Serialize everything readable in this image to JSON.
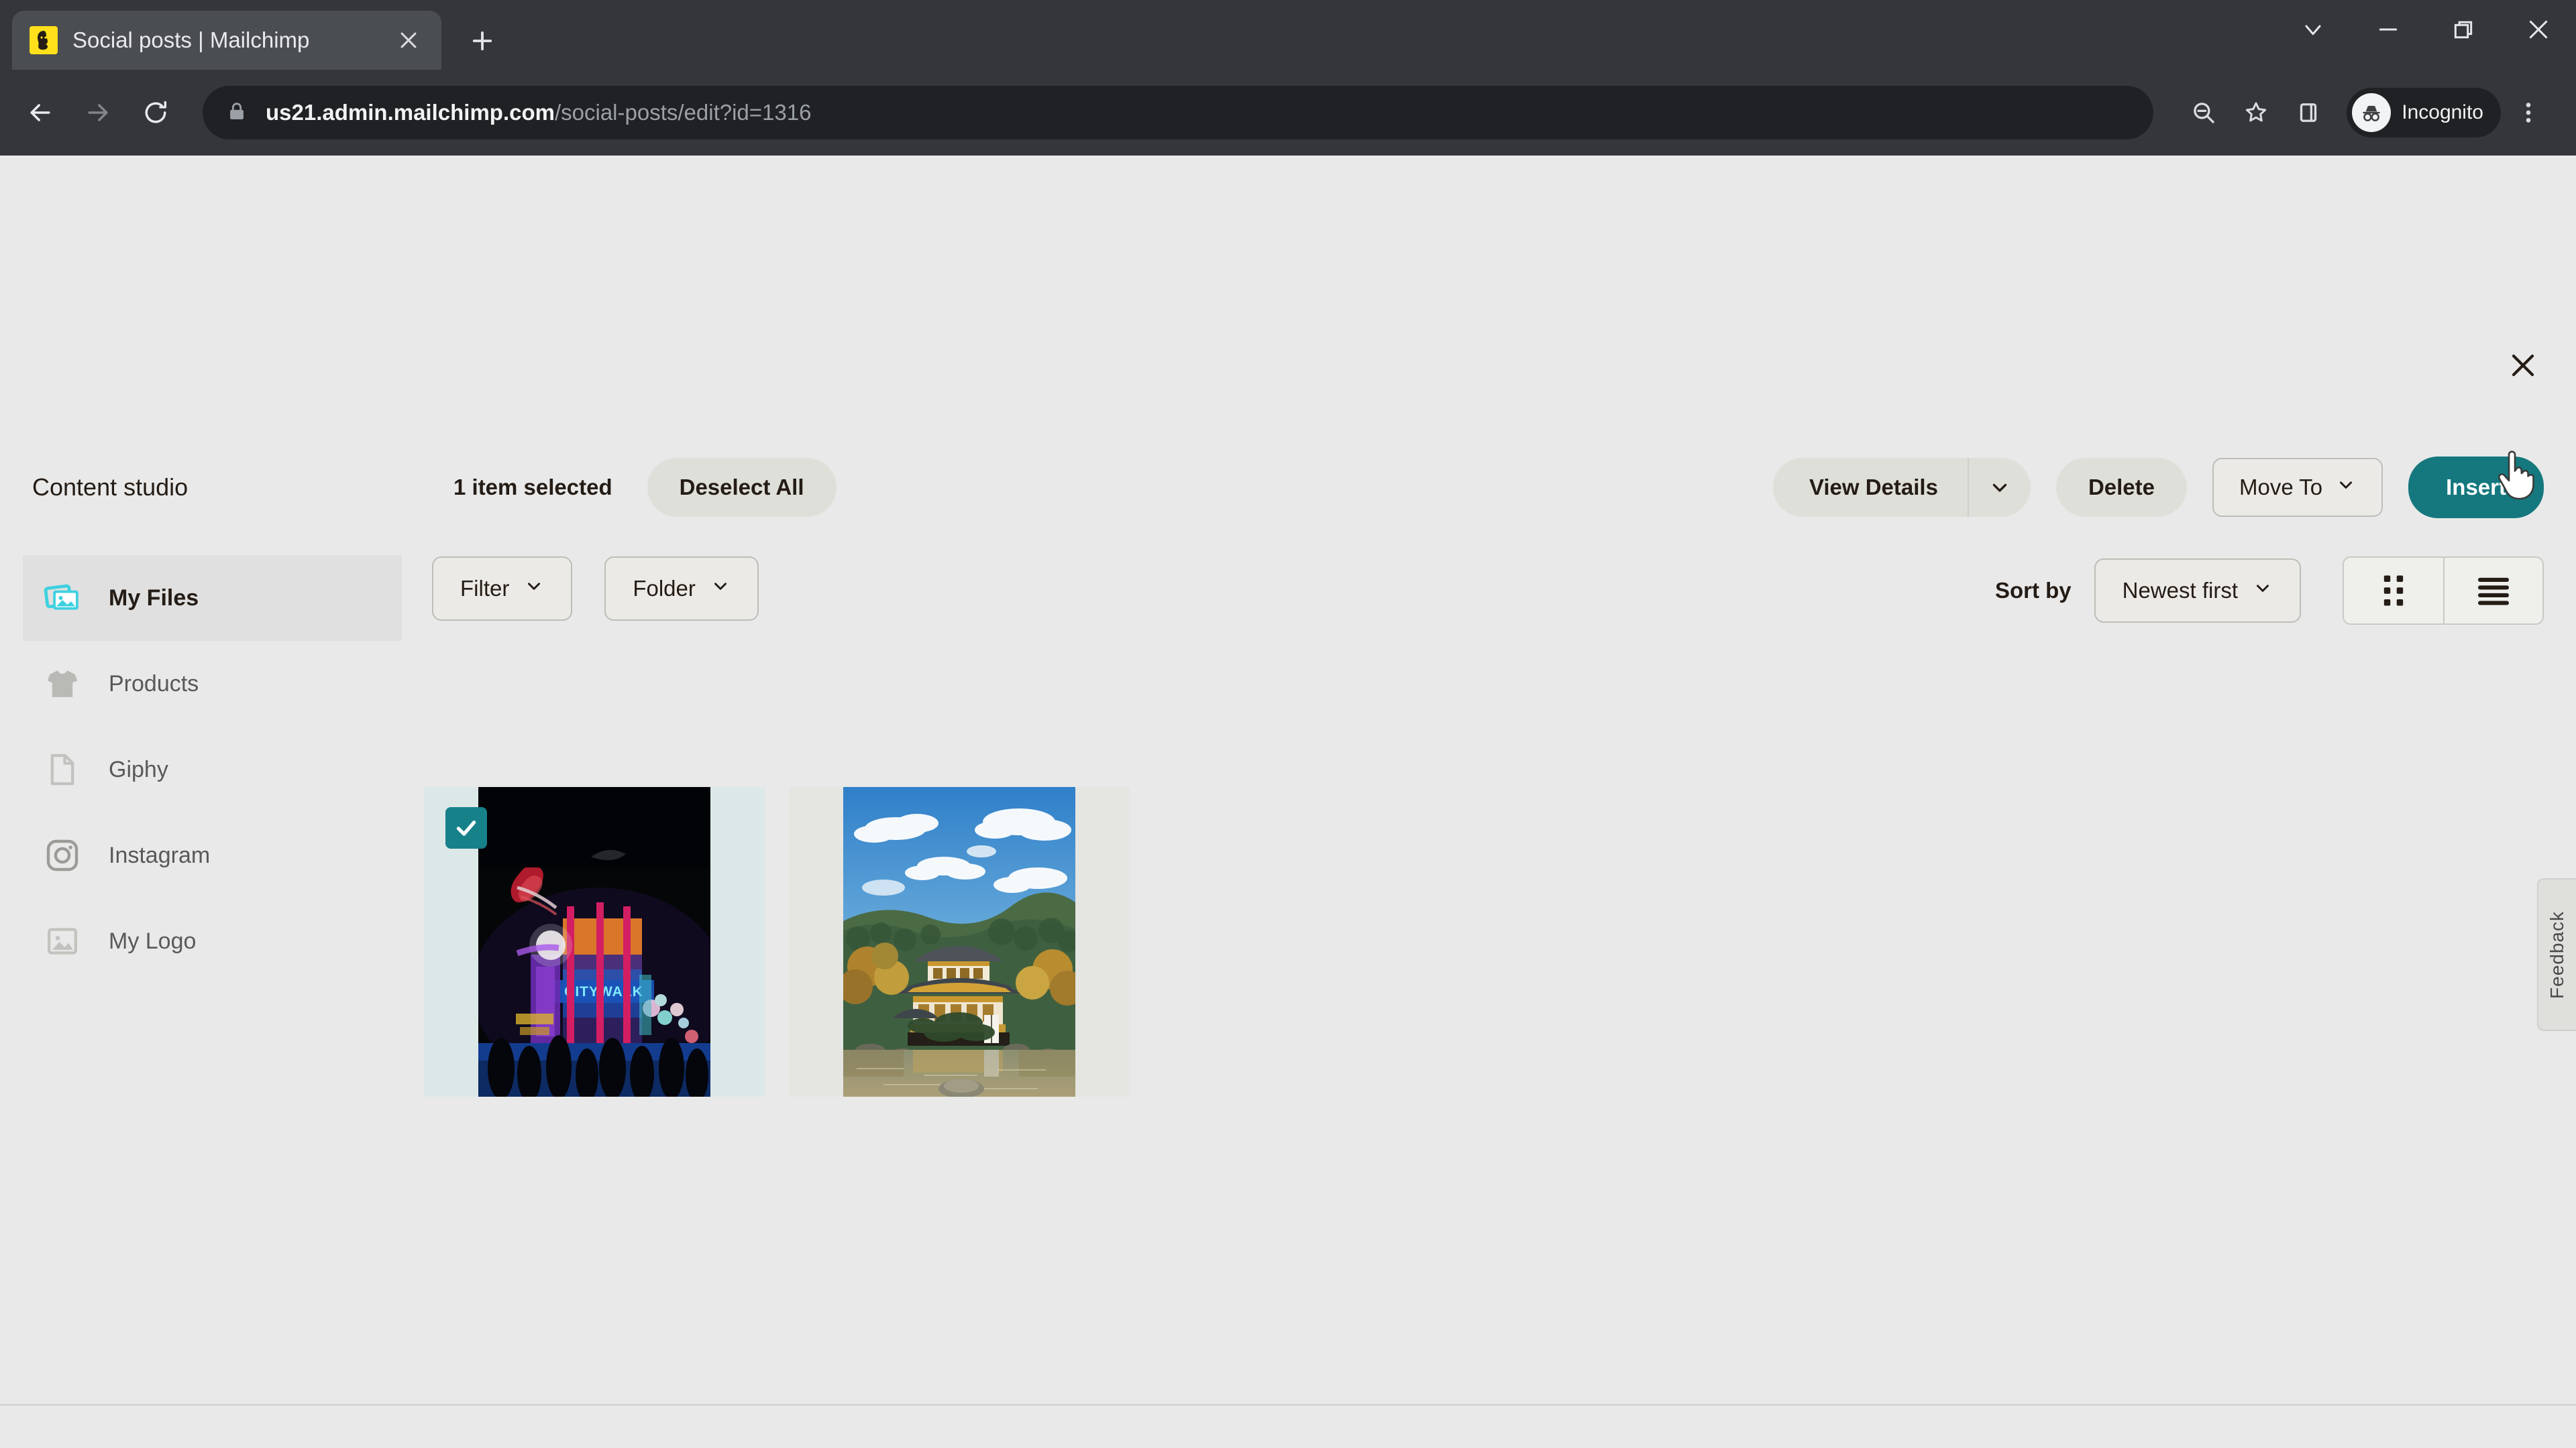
{
  "browser": {
    "tab": {
      "title": "Social posts | Mailchimp",
      "favicon_name": "mailchimp-favicon",
      "close_label": "×"
    },
    "new_tab_label": "+",
    "window_controls": [
      {
        "name": "tab-search-button",
        "glyph": "⌄"
      },
      {
        "name": "minimize-button",
        "glyph": "−"
      },
      {
        "name": "restore-button",
        "glyph": "❐"
      },
      {
        "name": "close-window-button",
        "glyph": "×"
      }
    ],
    "nav": {
      "back_label": "←",
      "forward_label": "→",
      "reload_label": "↻"
    },
    "omnibox": {
      "lock_icon": "lock-icon",
      "url_domain": "us21.admin.mailchimp.com",
      "url_path": "/social-posts/edit?id=1316",
      "full_url": "us21.admin.mailchimp.com/social-posts/edit?id=1316"
    },
    "toolbar_icons": [
      {
        "name": "zoom-out-icon",
        "label": "Zoom"
      },
      {
        "name": "bookmark-star-icon",
        "label": "Bookmark"
      },
      {
        "name": "side-panel-icon",
        "label": "Side panel"
      },
      {
        "name": "menu-kebab-icon",
        "label": "Customize and control"
      }
    ],
    "incognito": {
      "label": "Incognito",
      "icon_name": "incognito-icon"
    }
  },
  "modal": {
    "close_label": "×",
    "title": "Content studio",
    "selection": {
      "count_text": "1 item selected",
      "deselect_label": "Deselect All"
    },
    "actions": {
      "view_details_label": "View Details",
      "view_details_caret": "⌄",
      "delete_label": "Delete",
      "move_to_label": "Move To",
      "move_to_caret": "⌄",
      "insert_label": "Insert"
    }
  },
  "sidebar": {
    "items": [
      {
        "label": "My Files",
        "icon": "photos-stack-icon",
        "active": true
      },
      {
        "label": "Products",
        "icon": "tshirt-icon",
        "active": false
      },
      {
        "label": "Giphy",
        "icon": "document-icon",
        "active": false
      },
      {
        "label": "Instagram",
        "icon": "instagram-camera-icon",
        "active": false
      },
      {
        "label": "My Logo",
        "icon": "image-frame-icon",
        "active": false
      }
    ]
  },
  "content_toolbar": {
    "filter_label": "Filter",
    "filter_caret": "⌄",
    "folder_label": "Folder",
    "folder_caret": "⌄",
    "sort_by_label": "Sort by",
    "sort_value": "Newest first",
    "sort_caret": "⌄",
    "grid_view_icon": "grid-view-icon",
    "list_view_icon": "list-view-icon"
  },
  "grid": {
    "items": [
      {
        "name": "citywalk-night-photo",
        "alt": "Night city scene with neon signs and crowd",
        "selected": true,
        "check_glyph": "✓"
      },
      {
        "name": "golden-pavilion-photo",
        "alt": "Golden Pavilion temple beside a pond with autumn trees",
        "selected": false,
        "check_glyph": ""
      }
    ]
  },
  "feedback": {
    "label": "Feedback"
  },
  "colors": {
    "accent_teal": "#14787E",
    "selected_tile": "#DCE8E8",
    "page_bg": "#E9E9E9",
    "sidebar_active": "#E0E0E0",
    "active_icon_cyan": "#3DD1E0",
    "chrome_bg": "#35363A"
  }
}
